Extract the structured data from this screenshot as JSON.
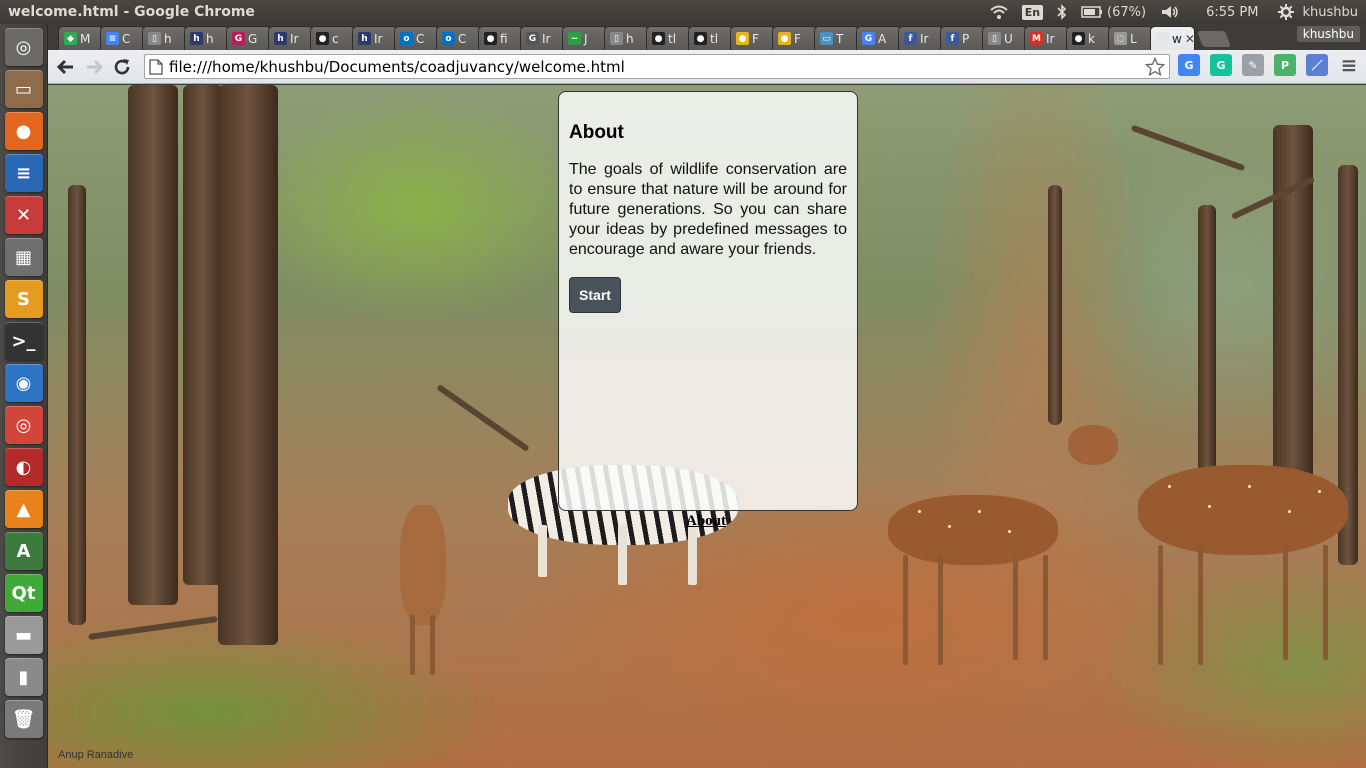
{
  "window": {
    "title": "welcome.html - Google Chrome"
  },
  "panel": {
    "lang": "En",
    "battery": "(67%)",
    "time": "6:55 PM",
    "user": "khushbu"
  },
  "launcher": {
    "items": [
      {
        "name": "dash-icon",
        "glyph": "◎",
        "color": "#6b6a66"
      },
      {
        "name": "files-icon",
        "glyph": "▭",
        "color": "#8d6b4b"
      },
      {
        "name": "firefox-icon",
        "glyph": "●",
        "color": "#e2661d"
      },
      {
        "name": "writer-icon",
        "glyph": "≡",
        "color": "#2a67b5"
      },
      {
        "name": "settings-icon",
        "glyph": "✕",
        "color": "#c73b3b"
      },
      {
        "name": "calculator-icon",
        "glyph": "▦",
        "color": "#6f6f6f"
      },
      {
        "name": "sublime-icon",
        "glyph": "S",
        "color": "#e59b1f"
      },
      {
        "name": "terminal-icon",
        "glyph": ">_",
        "color": "#333333"
      },
      {
        "name": "network-icon",
        "glyph": "◉",
        "color": "#2d74c4"
      },
      {
        "name": "chrome-icon",
        "glyph": "◎",
        "color": "#d1453b"
      },
      {
        "name": "app-red-icon",
        "glyph": "◐",
        "color": "#b22a2a"
      },
      {
        "name": "vlc-icon",
        "glyph": "▲",
        "color": "#e8821a"
      },
      {
        "name": "software-center-icon",
        "glyph": "A",
        "color": "#3d7a3d"
      },
      {
        "name": "qt-icon",
        "glyph": "Qt",
        "color": "#41a83a"
      },
      {
        "name": "drive-icon",
        "glyph": "▬",
        "color": "#9a9a9a"
      },
      {
        "name": "usb-icon",
        "glyph": "▮",
        "color": "#8a8a8a"
      },
      {
        "name": "trash-icon",
        "glyph": "🗑",
        "color": "#7a7a7a"
      }
    ]
  },
  "tabs": [
    {
      "fav": "◆",
      "favcolor": "#34a853",
      "label": "M"
    },
    {
      "fav": "≡",
      "favcolor": "#4285f4",
      "label": "C"
    },
    {
      "fav": "▯",
      "favcolor": "#888888",
      "label": "h"
    },
    {
      "fav": "h",
      "favcolor": "#2e3a6e",
      "label": "h"
    },
    {
      "fav": "G",
      "favcolor": "#c2185b",
      "label": "G"
    },
    {
      "fav": "h",
      "favcolor": "#2e3a6e",
      "label": "Ir"
    },
    {
      "fav": "●",
      "favcolor": "#222222",
      "label": "c"
    },
    {
      "fav": "h",
      "favcolor": "#2e3a6e",
      "label": "Ir"
    },
    {
      "fav": "o",
      "favcolor": "#0072c6",
      "label": "C"
    },
    {
      "fav": "o",
      "favcolor": "#0072c6",
      "label": "C"
    },
    {
      "fav": "●",
      "favcolor": "#222222",
      "label": "fi"
    },
    {
      "fav": "G",
      "favcolor": "#555555",
      "label": "Ir"
    },
    {
      "fav": "~",
      "favcolor": "#2e9e44",
      "label": "J"
    },
    {
      "fav": "▯",
      "favcolor": "#888888",
      "label": "h"
    },
    {
      "fav": "●",
      "favcolor": "#222222",
      "label": "tl"
    },
    {
      "fav": "●",
      "favcolor": "#222222",
      "label": "tl"
    },
    {
      "fav": "●",
      "favcolor": "#e8b21a",
      "label": "F"
    },
    {
      "fav": "●",
      "favcolor": "#e8b21a",
      "label": "F"
    },
    {
      "fav": "▭",
      "favcolor": "#4a90c2",
      "label": "T"
    },
    {
      "fav": "G",
      "favcolor": "#4285f4",
      "label": "A"
    },
    {
      "fav": "f",
      "favcolor": "#3b5998",
      "label": "Ir"
    },
    {
      "fav": "f",
      "favcolor": "#3b5998",
      "label": "P"
    },
    {
      "fav": "▯",
      "favcolor": "#888888",
      "label": "U"
    },
    {
      "fav": "M",
      "favcolor": "#d93025",
      "label": "Ir"
    },
    {
      "fav": "●",
      "favcolor": "#222222",
      "label": "k"
    },
    {
      "fav": "◌",
      "favcolor": "#999999",
      "label": "L"
    },
    {
      "fav": "",
      "favcolor": "#e3e6ea",
      "label": "w",
      "active": true
    }
  ],
  "profile": "khushbu",
  "toolbar": {
    "url": "file:///home/khushbu/Documents/coadjuvancy/welcome.html"
  },
  "extensions": [
    {
      "name": "google-translate-icon",
      "glyph": "G",
      "color": "#4285f4"
    },
    {
      "name": "grammarly-icon",
      "glyph": "G",
      "color": "#15c39a"
    },
    {
      "name": "pen-tool-icon",
      "glyph": "✎",
      "color": "#9aa0a6"
    },
    {
      "name": "pushbullet-icon",
      "glyph": "P",
      "color": "#4ab367"
    },
    {
      "name": "pencil-icon",
      "glyph": "／",
      "color": "#5b7fd1"
    },
    {
      "name": "menu-icon",
      "glyph": "≡",
      "color": "#555555"
    }
  ],
  "card": {
    "heading": "About",
    "text": "The goals of wildlife conservation are to ensure that nature will be around for future generations. So you can share your ideas by predefined messages to encourage and aware your friends.",
    "button": "Start"
  },
  "about_link": "About",
  "photo_credit": "Anup Ranadive"
}
